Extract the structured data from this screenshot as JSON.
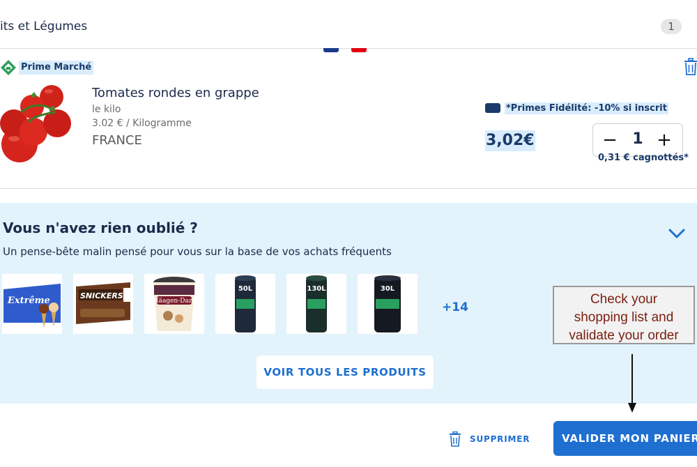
{
  "section": {
    "title": "its et Légumes",
    "count": "1"
  },
  "product": {
    "badge": "Prime Marché",
    "name": "Tomates rondes en grappe",
    "unit": "le kilo",
    "price_per_kg": "3.02 € / Kilogramme",
    "origin": "FRANCE",
    "fidelity": "*Primes Fidélité: -10% si inscrit",
    "price": "3,02€",
    "quantity": "1",
    "minus_symbol": "−",
    "plus_symbol": "+",
    "cagnotte": "0,31 € cagnottés*"
  },
  "reminder": {
    "title": "Vous n'avez rien oublié ?",
    "subtitle": "Un pense-bête malin pensé pour vous sur la base de vos achats fréquents",
    "more_count": "+14",
    "see_all_button": "VOIR TOUS LES PRODUITS",
    "thumbnails": [
      {
        "icon": "ice-cream-cones-box",
        "text": "Extrême"
      },
      {
        "icon": "ice-cream-bars-box",
        "text": "SNICKERS"
      },
      {
        "icon": "ice-cream-tub",
        "text": "Häagen-Dazs"
      },
      {
        "icon": "trash-bag-roll",
        "text": "50L"
      },
      {
        "icon": "trash-bag-roll",
        "text": "130L"
      },
      {
        "icon": "trash-bag-roll",
        "text": "30L"
      }
    ]
  },
  "annotation": {
    "line1": "Check your",
    "line2": "shopping list and",
    "line3": "validate your order"
  },
  "footer": {
    "delete_label": "SUPPRIMER",
    "validate_label": "VALIDER MON PANIER"
  },
  "colors": {
    "accent": "#1e6fd0",
    "navy": "#1a3a6a",
    "highlight": "#d8ecfb",
    "panel": "#e3f3fc",
    "annotation_text": "#7a2010"
  }
}
